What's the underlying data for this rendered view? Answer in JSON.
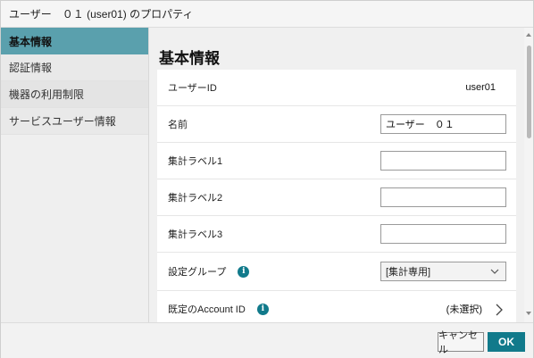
{
  "window": {
    "title": "ユーザー　０１ (user01) のプロパティ"
  },
  "sidebar": {
    "items": [
      {
        "label": "基本情報",
        "active": true
      },
      {
        "label": "認証情報"
      },
      {
        "label": "機器の利用制限"
      },
      {
        "label": "サービスユーザー情報"
      }
    ]
  },
  "main": {
    "heading": "基本情報",
    "rows": {
      "user_id": {
        "label": "ユーザーID",
        "value": "user01"
      },
      "name": {
        "label": "名前",
        "value": "ユーザー　０１"
      },
      "label1": {
        "label": "集計ラベル1",
        "value": ""
      },
      "label2": {
        "label": "集計ラベル2",
        "value": ""
      },
      "label3": {
        "label": "集計ラベル3",
        "value": ""
      },
      "group": {
        "label": "設定グループ",
        "selected": "[集計専用]",
        "info_icon": "info-icon"
      },
      "account": {
        "label": "既定のAccount ID",
        "value": "(未選択)",
        "info_icon": "info-icon"
      }
    }
  },
  "footer": {
    "cancel_label": "キャンセル",
    "ok_label": "OK"
  },
  "colors": {
    "accent": "#117a8b",
    "sidebar_active": "#5aa0ad"
  }
}
